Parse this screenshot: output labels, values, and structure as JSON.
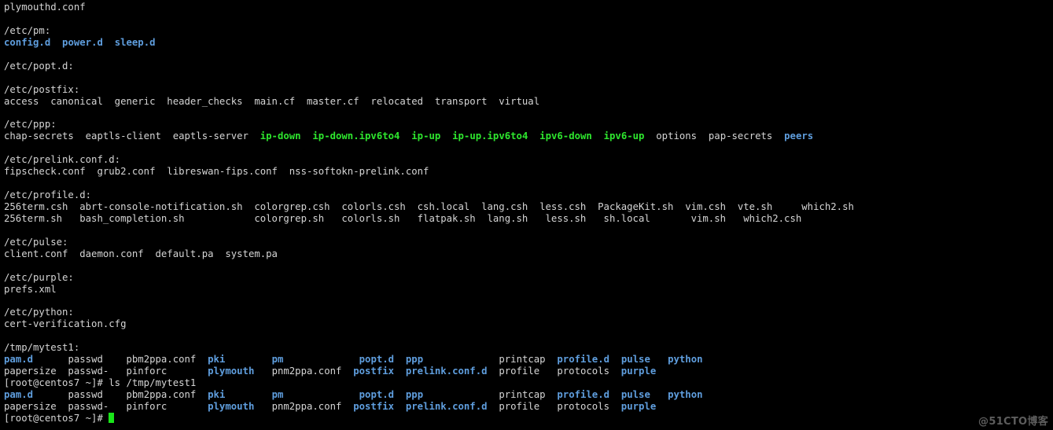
{
  "terminal": {
    "background_color": "#000000",
    "default_text_color": "#d5d5d5",
    "directory_color": "#5f9ede",
    "executable_color": "#2ee62e",
    "cursor_color": "#19e619",
    "prompt": "[root@centos7 ~]# ",
    "command": "ls /tmp/mytest1",
    "lines": [
      {
        "id": "l01",
        "segments": [
          {
            "text": "plymouthd.conf",
            "style": "default"
          }
        ]
      },
      {
        "id": "l02",
        "segments": [
          {
            "text": "",
            "style": "default"
          }
        ]
      },
      {
        "id": "l03",
        "segments": [
          {
            "text": "/etc/pm:",
            "style": "default"
          }
        ]
      },
      {
        "id": "l04",
        "segments": [
          {
            "text": "config.d",
            "style": "dir"
          },
          {
            "text": "  ",
            "style": "default"
          },
          {
            "text": "power.d",
            "style": "dir"
          },
          {
            "text": "  ",
            "style": "default"
          },
          {
            "text": "sleep.d",
            "style": "dir"
          }
        ]
      },
      {
        "id": "l05",
        "segments": [
          {
            "text": "",
            "style": "default"
          }
        ]
      },
      {
        "id": "l06",
        "segments": [
          {
            "text": "/etc/popt.d:",
            "style": "default"
          }
        ]
      },
      {
        "id": "l07",
        "segments": [
          {
            "text": "",
            "style": "default"
          }
        ]
      },
      {
        "id": "l08",
        "segments": [
          {
            "text": "/etc/postfix:",
            "style": "default"
          }
        ]
      },
      {
        "id": "l09",
        "segments": [
          {
            "text": "access  canonical  generic  header_checks  main.cf  master.cf  relocated  transport  virtual",
            "style": "default"
          }
        ]
      },
      {
        "id": "l10",
        "segments": [
          {
            "text": "",
            "style": "default"
          }
        ]
      },
      {
        "id": "l11",
        "segments": [
          {
            "text": "/etc/ppp:",
            "style": "default"
          }
        ]
      },
      {
        "id": "l12",
        "segments": [
          {
            "text": "chap-secrets  eaptls-client  eaptls-server  ",
            "style": "default"
          },
          {
            "text": "ip-down",
            "style": "exec"
          },
          {
            "text": "  ",
            "style": "default"
          },
          {
            "text": "ip-down.ipv6to4",
            "style": "exec"
          },
          {
            "text": "  ",
            "style": "default"
          },
          {
            "text": "ip-up",
            "style": "exec"
          },
          {
            "text": "  ",
            "style": "default"
          },
          {
            "text": "ip-up.ipv6to4",
            "style": "exec"
          },
          {
            "text": "  ",
            "style": "default"
          },
          {
            "text": "ipv6-down",
            "style": "exec"
          },
          {
            "text": "  ",
            "style": "default"
          },
          {
            "text": "ipv6-up",
            "style": "exec"
          },
          {
            "text": "  options  pap-secrets  ",
            "style": "default"
          },
          {
            "text": "peers",
            "style": "dir"
          }
        ]
      },
      {
        "id": "l13",
        "segments": [
          {
            "text": "",
            "style": "default"
          }
        ]
      },
      {
        "id": "l14",
        "segments": [
          {
            "text": "/etc/prelink.conf.d:",
            "style": "default"
          }
        ]
      },
      {
        "id": "l15",
        "segments": [
          {
            "text": "fipscheck.conf  grub2.conf  libreswan-fips.conf  nss-softokn-prelink.conf",
            "style": "default"
          }
        ]
      },
      {
        "id": "l16",
        "segments": [
          {
            "text": "",
            "style": "default"
          }
        ]
      },
      {
        "id": "l17",
        "segments": [
          {
            "text": "/etc/profile.d:",
            "style": "default"
          }
        ]
      },
      {
        "id": "l18",
        "segments": [
          {
            "text": "256term.csh  abrt-console-notification.sh  colorgrep.csh  colorls.csh  csh.local  lang.csh  less.csh  PackageKit.sh  vim.csh  vte.sh     which2.sh",
            "style": "default"
          }
        ]
      },
      {
        "id": "l19",
        "segments": [
          {
            "text": "256term.sh   bash_completion.sh            colorgrep.sh   colorls.sh   flatpak.sh  lang.sh   less.sh   sh.local       vim.sh   which2.csh",
            "style": "default"
          }
        ]
      },
      {
        "id": "l20",
        "segments": [
          {
            "text": "",
            "style": "default"
          }
        ]
      },
      {
        "id": "l21",
        "segments": [
          {
            "text": "/etc/pulse:",
            "style": "default"
          }
        ]
      },
      {
        "id": "l22",
        "segments": [
          {
            "text": "client.conf  daemon.conf  default.pa  system.pa",
            "style": "default"
          }
        ]
      },
      {
        "id": "l23",
        "segments": [
          {
            "text": "",
            "style": "default"
          }
        ]
      },
      {
        "id": "l24",
        "segments": [
          {
            "text": "/etc/purple:",
            "style": "default"
          }
        ]
      },
      {
        "id": "l25",
        "segments": [
          {
            "text": "prefs.xml",
            "style": "default"
          }
        ]
      },
      {
        "id": "l26",
        "segments": [
          {
            "text": "",
            "style": "default"
          }
        ]
      },
      {
        "id": "l27",
        "segments": [
          {
            "text": "/etc/python:",
            "style": "default"
          }
        ]
      },
      {
        "id": "l28",
        "segments": [
          {
            "text": "cert-verification.cfg",
            "style": "default"
          }
        ]
      },
      {
        "id": "l29",
        "segments": [
          {
            "text": "",
            "style": "default"
          }
        ]
      },
      {
        "id": "l30",
        "segments": [
          {
            "text": "/tmp/mytest1:",
            "style": "default"
          }
        ]
      },
      {
        "id": "l31",
        "segments": [
          {
            "text": "pam.d",
            "style": "dir"
          },
          {
            "text": "      passwd    pbm2ppa.conf  ",
            "style": "default"
          },
          {
            "text": "pki",
            "style": "dir"
          },
          {
            "text": "        ",
            "style": "default"
          },
          {
            "text": "pm",
            "style": "dir"
          },
          {
            "text": "             ",
            "style": "default"
          },
          {
            "text": "popt.d",
            "style": "dir"
          },
          {
            "text": "  ",
            "style": "default"
          },
          {
            "text": "ppp",
            "style": "dir"
          },
          {
            "text": "             printcap  ",
            "style": "default"
          },
          {
            "text": "profile.d",
            "style": "dir"
          },
          {
            "text": "  ",
            "style": "default"
          },
          {
            "text": "pulse",
            "style": "dir"
          },
          {
            "text": "   ",
            "style": "default"
          },
          {
            "text": "python",
            "style": "dir"
          }
        ]
      },
      {
        "id": "l32",
        "segments": [
          {
            "text": "papersize  passwd-   pinforc       ",
            "style": "default"
          },
          {
            "text": "plymouth",
            "style": "dir"
          },
          {
            "text": "   pnm2ppa.conf  ",
            "style": "default"
          },
          {
            "text": "postfix",
            "style": "dir"
          },
          {
            "text": "  ",
            "style": "default"
          },
          {
            "text": "prelink.conf.d",
            "style": "dir"
          },
          {
            "text": "  profile   protocols  ",
            "style": "default"
          },
          {
            "text": "purple",
            "style": "dir"
          }
        ]
      },
      {
        "id": "l33",
        "segments": [
          {
            "text": "[root@centos7 ~]# ls /tmp/mytest1",
            "style": "prompt"
          }
        ]
      },
      {
        "id": "l34",
        "segments": [
          {
            "text": "pam.d",
            "style": "dir"
          },
          {
            "text": "      passwd    pbm2ppa.conf  ",
            "style": "default"
          },
          {
            "text": "pki",
            "style": "dir"
          },
          {
            "text": "        ",
            "style": "default"
          },
          {
            "text": "pm",
            "style": "dir"
          },
          {
            "text": "             ",
            "style": "default"
          },
          {
            "text": "popt.d",
            "style": "dir"
          },
          {
            "text": "  ",
            "style": "default"
          },
          {
            "text": "ppp",
            "style": "dir"
          },
          {
            "text": "             printcap  ",
            "style": "default"
          },
          {
            "text": "profile.d",
            "style": "dir"
          },
          {
            "text": "  ",
            "style": "default"
          },
          {
            "text": "pulse",
            "style": "dir"
          },
          {
            "text": "   ",
            "style": "default"
          },
          {
            "text": "python",
            "style": "dir"
          }
        ]
      },
      {
        "id": "l35",
        "segments": [
          {
            "text": "papersize  passwd-   pinforc       ",
            "style": "default"
          },
          {
            "text": "plymouth",
            "style": "dir"
          },
          {
            "text": "   pnm2ppa.conf  ",
            "style": "default"
          },
          {
            "text": "postfix",
            "style": "dir"
          },
          {
            "text": "  ",
            "style": "default"
          },
          {
            "text": "prelink.conf.d",
            "style": "dir"
          },
          {
            "text": "  profile   protocols  ",
            "style": "default"
          },
          {
            "text": "purple",
            "style": "dir"
          }
        ]
      },
      {
        "id": "l36",
        "segments": [
          {
            "text": "[root@centos7 ~]# ",
            "style": "prompt"
          },
          {
            "text": "",
            "style": "cursor"
          }
        ]
      }
    ]
  },
  "watermark": {
    "text": "@51CTO博客"
  }
}
